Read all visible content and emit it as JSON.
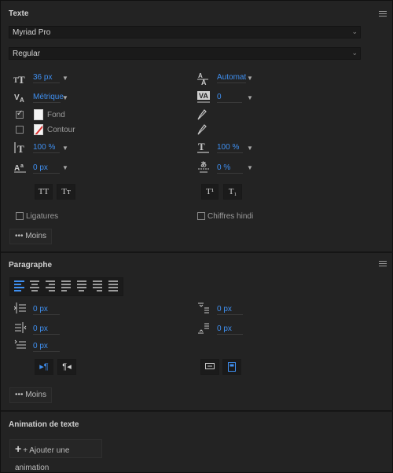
{
  "texte": {
    "title": "Texte",
    "font_family": "Myriad Pro",
    "font_style": "Regular",
    "font_size": "36 px",
    "leading": "Automatic",
    "kerning": "Métrique",
    "tracking": "0",
    "fill_label": "Fond",
    "stroke_label": "Contour",
    "vertical_scale": "100 %",
    "horizontal_scale": "100 %",
    "baseline_shift": "0 px",
    "tsume": "0 %",
    "all_caps": "TT",
    "small_caps": "Tт",
    "superscript": "T¹",
    "subscript": "T₁",
    "ligatures_label": "Ligatures",
    "hindi_label": "Chiffres hindi",
    "more_label": "••• Moins",
    "fill_checked": true,
    "stroke_checked": false
  },
  "paragraphe": {
    "title": "Paragraphe",
    "indent_left": "0 px",
    "indent_first": "0 px",
    "indent_right": "0 px",
    "space_before": "0 px",
    "space_after": "0 px",
    "ltr": "▸¶",
    "rtl": "¶◂",
    "more_label": "••• Moins",
    "align_active": "left"
  },
  "animation": {
    "title": "Animation de texte",
    "add_label": "+ Ajouter une animation"
  },
  "colors": {
    "accent": "#3f8ff0",
    "panel": "#232323",
    "field": "#1a1a1a"
  },
  "icons": {
    "chevron": "chevron-down-icon",
    "menu": "hamburger-icon",
    "eyedropper": "eyedropper-icon",
    "plus": "plus-icon"
  }
}
